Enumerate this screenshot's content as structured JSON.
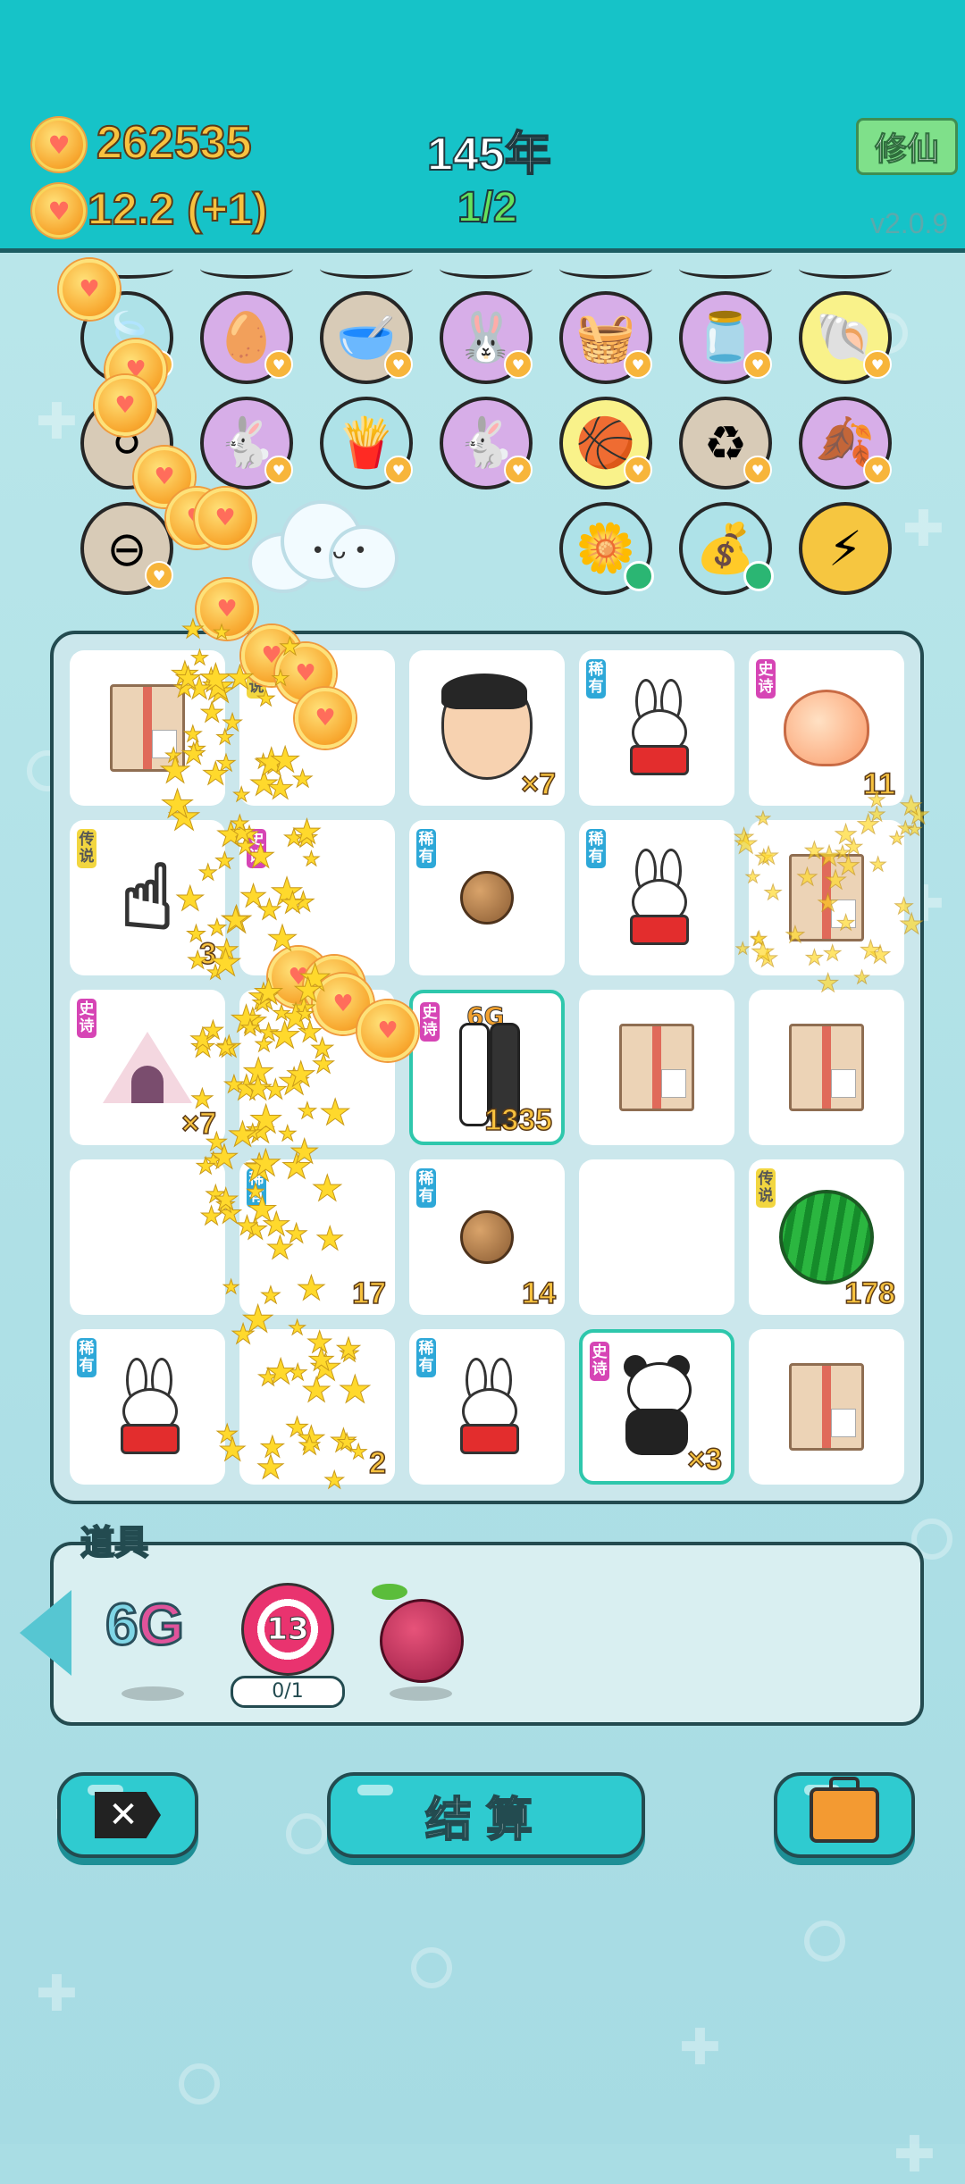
{
  "header": {
    "coins": "262535",
    "rate": "12.2 (+1)",
    "year": "145年",
    "progress": "1/2",
    "mode_button": "修仙",
    "version": "v2.0.9"
  },
  "top_icons": [
    {
      "name": "leaf-icon",
      "bg": "teal",
      "glyph": "🍃"
    },
    {
      "name": "egg-icon",
      "bg": "purple",
      "glyph": "🥚"
    },
    {
      "name": "pet-food-bowl-icon",
      "bg": "tan",
      "glyph": "🥣"
    },
    {
      "name": "rabbit-box-icon",
      "bg": "purple",
      "glyph": "🐰"
    },
    {
      "name": "fruit-basket-icon",
      "bg": "purple",
      "glyph": "🧺"
    },
    {
      "name": "jar-icon",
      "bg": "purple",
      "glyph": "🫙"
    },
    {
      "name": "shell-icon",
      "bg": "yellow",
      "glyph": "🐚"
    },
    {
      "name": "egg-tray-icon",
      "bg": "tan",
      "glyph": "⚪"
    },
    {
      "name": "rabbit-icon",
      "bg": "purple",
      "glyph": "🐇"
    },
    {
      "name": "fries-icon",
      "bg": "teal",
      "glyph": "🍟"
    },
    {
      "name": "rabbit-icon-2",
      "bg": "purple",
      "glyph": "🐇"
    },
    {
      "name": "balls-icon",
      "bg": "yellow",
      "glyph": "🏀"
    },
    {
      "name": "refresh-icon",
      "bg": "tan",
      "glyph": "♻"
    },
    {
      "name": "leaf-icon-2",
      "bg": "purple",
      "glyph": "🍂"
    },
    {
      "name": "minus-icon",
      "bg": "tan",
      "glyph": "⊖"
    },
    {
      "name": "flower-pot-icon",
      "bg": "teal",
      "glyph": "🌼"
    },
    {
      "name": "sack-icon",
      "bg": "teal",
      "glyph": "💰"
    },
    {
      "name": "lightning-icon",
      "bg": "gold",
      "glyph": "⚡"
    }
  ],
  "board": {
    "cells": [
      {
        "item": "box",
        "tag": "",
        "count": ""
      },
      {
        "item": "empty",
        "tag": "传说",
        "count": ""
      },
      {
        "item": "face",
        "tag": "",
        "count": "×7"
      },
      {
        "item": "rabbit",
        "tag": "稀有",
        "count": ""
      },
      {
        "item": "peach",
        "tag": "史诗",
        "count": "11"
      },
      {
        "item": "hand",
        "tag": "传说",
        "count": "3"
      },
      {
        "item": "empty",
        "tag": "史诗",
        "count": ""
      },
      {
        "item": "nut",
        "tag": "稀有",
        "count": ""
      },
      {
        "item": "rabbit",
        "tag": "稀有",
        "count": ""
      },
      {
        "item": "box",
        "tag": "",
        "count": ""
      },
      {
        "item": "tent",
        "tag": "史诗",
        "count": "×7"
      },
      {
        "item": "empty",
        "tag": "",
        "count": ""
      },
      {
        "item": "scroll6g",
        "tag": "史诗",
        "count": "1335"
      },
      {
        "item": "box",
        "tag": "",
        "count": ""
      },
      {
        "item": "box",
        "tag": "",
        "count": ""
      },
      {
        "item": "empty",
        "tag": "",
        "count": ""
      },
      {
        "item": "empty",
        "tag": "稀有",
        "count": "17"
      },
      {
        "item": "nut",
        "tag": "稀有",
        "count": "14"
      },
      {
        "item": "empty",
        "tag": "",
        "count": ""
      },
      {
        "item": "melon",
        "tag": "传说",
        "count": "178"
      },
      {
        "item": "rabbit",
        "tag": "稀有",
        "count": ""
      },
      {
        "item": "empty",
        "tag": "",
        "count": "2"
      },
      {
        "item": "rabbit",
        "tag": "稀有",
        "count": ""
      },
      {
        "item": "panda",
        "tag": "史诗",
        "count": "×3"
      },
      {
        "item": "box",
        "tag": "",
        "count": ""
      }
    ]
  },
  "tools": {
    "title": "道具",
    "item_6g": "6G",
    "target_value": "13",
    "target_uses": "0/1"
  },
  "buttons": {
    "settle": "结算"
  }
}
